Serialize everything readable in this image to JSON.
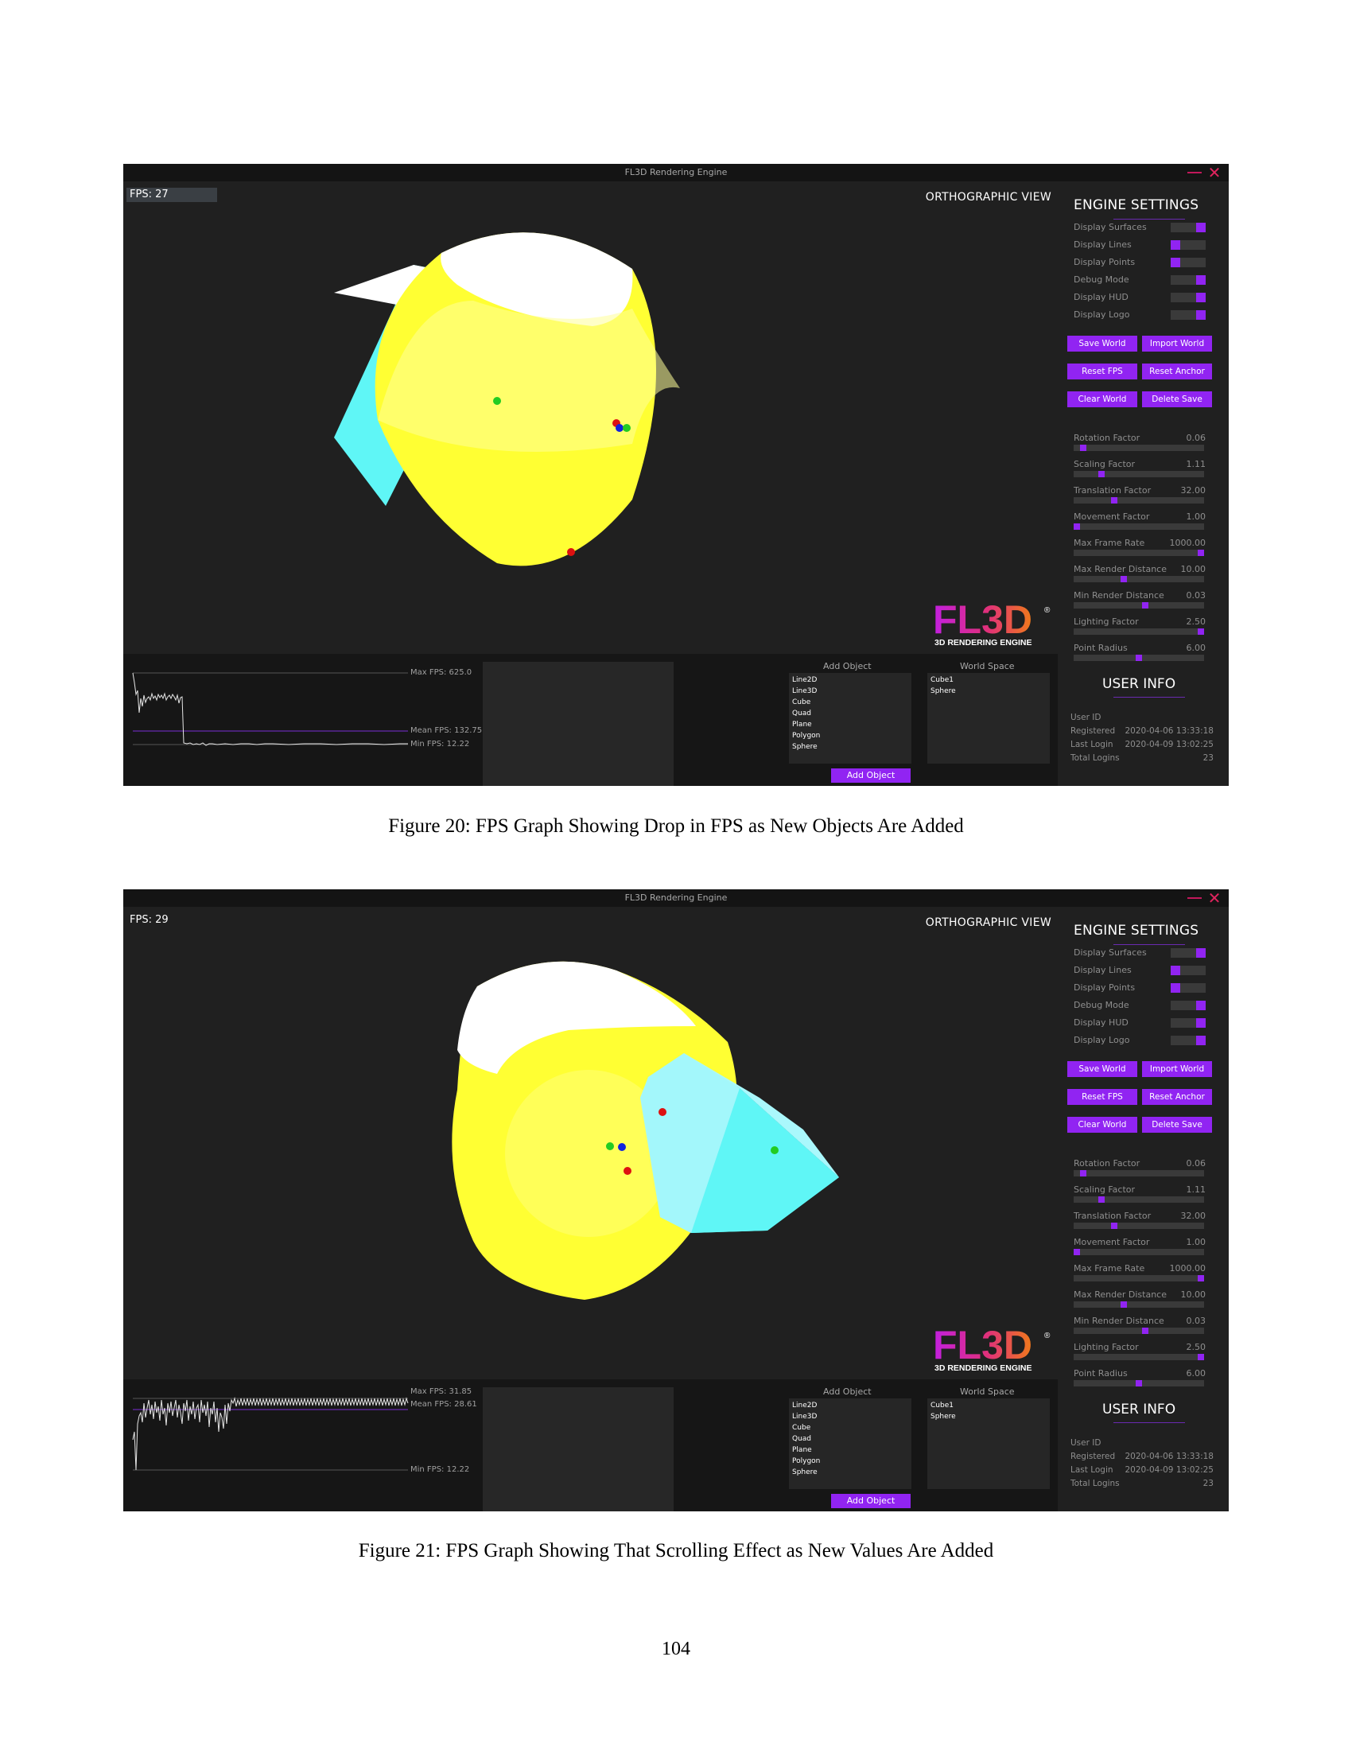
{
  "figures": [
    {
      "window_title": "FL3D Rendering Engine",
      "fps": "FPS: 27",
      "view_label": "ORTHOGRAPHIC VIEW",
      "logo": {
        "text": "FL3D",
        "subtitle": "3D RENDERING ENGINE",
        "mark": "®"
      },
      "graph": {
        "max_label": "Max FPS: 625.0",
        "mean_label": "Mean FPS: 132.75",
        "min_label": "Min FPS: 12.22"
      },
      "add_object": {
        "title": "Add Object",
        "items": [
          "Line2D",
          "Line3D",
          "Cube",
          "Quad",
          "Plane",
          "Polygon",
          "Sphere"
        ],
        "button": "Add Object"
      },
      "world_space": {
        "title": "World Space",
        "items": [
          "Cube1",
          "Sphere"
        ]
      },
      "settings": {
        "title": "ENGINE SETTINGS",
        "toggles": [
          {
            "label": "Display Surfaces",
            "on": true
          },
          {
            "label": "Display Lines",
            "on": false
          },
          {
            "label": "Display Points",
            "on": false
          },
          {
            "label": "Debug Mode",
            "on": true
          },
          {
            "label": "Display HUD",
            "on": true
          },
          {
            "label": "Display Logo",
            "on": true
          }
        ],
        "buttons": [
          "Save World",
          "Import World",
          "Reset FPS",
          "Reset Anchor",
          "Clear World",
          "Delete Save"
        ],
        "sliders": [
          {
            "label": "Rotation Factor",
            "value": "0.06",
            "level": 0.05
          },
          {
            "label": "Scaling Factor",
            "value": "1.11",
            "level": 0.2
          },
          {
            "label": "Translation Factor",
            "value": "32.00",
            "level": 0.3
          },
          {
            "label": "Movement Factor",
            "value": "1.00",
            "level": 0.0
          },
          {
            "label": "Max Frame Rate",
            "value": "1000.00",
            "level": 1.0
          },
          {
            "label": "Max Render Distance",
            "value": "10.00",
            "level": 0.38
          },
          {
            "label": "Min Render Distance",
            "value": "0.03",
            "level": 0.55
          },
          {
            "label": "Lighting Factor",
            "value": "2.50",
            "level": 1.0
          },
          {
            "label": "Point Radius",
            "value": "6.00",
            "level": 0.5
          }
        ]
      },
      "user_info": {
        "title": "USER INFO",
        "rows": [
          {
            "label": "User ID",
            "value": ""
          },
          {
            "label": "Registered",
            "value": "2020-04-06 13:33:18"
          },
          {
            "label": "Last Login",
            "value": "2020-04-09 13:02:25"
          },
          {
            "label": "Total Logins",
            "value": "23"
          }
        ]
      },
      "caption": "Figure 20: FPS Graph Showing Drop in FPS as New Objects Are Added"
    },
    {
      "window_title": "FL3D Rendering Engine",
      "fps": "FPS: 29",
      "view_label": "ORTHOGRAPHIC VIEW",
      "logo": {
        "text": "FL3D",
        "subtitle": "3D RENDERING ENGINE",
        "mark": "®"
      },
      "graph": {
        "max_label": "Max FPS: 31.85",
        "mean_label": "Mean FPS: 28.61",
        "min_label": "Min FPS: 12.22"
      },
      "add_object": {
        "title": "Add Object",
        "items": [
          "Line2D",
          "Line3D",
          "Cube",
          "Quad",
          "Plane",
          "Polygon",
          "Sphere"
        ],
        "button": "Add Object"
      },
      "world_space": {
        "title": "World Space",
        "items": [
          "Cube1",
          "Sphere"
        ]
      },
      "settings": {
        "title": "ENGINE SETTINGS",
        "toggles": [
          {
            "label": "Display Surfaces",
            "on": true
          },
          {
            "label": "Display Lines",
            "on": false
          },
          {
            "label": "Display Points",
            "on": false
          },
          {
            "label": "Debug Mode",
            "on": true
          },
          {
            "label": "Display HUD",
            "on": true
          },
          {
            "label": "Display Logo",
            "on": true
          }
        ],
        "buttons": [
          "Save World",
          "Import World",
          "Reset FPS",
          "Reset Anchor",
          "Clear World",
          "Delete Save"
        ],
        "sliders": [
          {
            "label": "Rotation Factor",
            "value": "0.06",
            "level": 0.05
          },
          {
            "label": "Scaling Factor",
            "value": "1.11",
            "level": 0.2
          },
          {
            "label": "Translation Factor",
            "value": "32.00",
            "level": 0.3
          },
          {
            "label": "Movement Factor",
            "value": "1.00",
            "level": 0.0
          },
          {
            "label": "Max Frame Rate",
            "value": "1000.00",
            "level": 1.0
          },
          {
            "label": "Max Render Distance",
            "value": "10.00",
            "level": 0.38
          },
          {
            "label": "Min Render Distance",
            "value": "0.03",
            "level": 0.55
          },
          {
            "label": "Lighting Factor",
            "value": "2.50",
            "level": 1.0
          },
          {
            "label": "Point Radius",
            "value": "6.00",
            "level": 0.5
          }
        ]
      },
      "user_info": {
        "title": "USER INFO",
        "rows": [
          {
            "label": "User ID",
            "value": ""
          },
          {
            "label": "Registered",
            "value": "2020-04-06 13:33:18"
          },
          {
            "label": "Last Login",
            "value": "2020-04-09 13:02:25"
          },
          {
            "label": "Total Logins",
            "value": "23"
          }
        ]
      },
      "caption": "Figure 21: FPS Graph Showing That Scrolling Effect as New Values Are Added"
    }
  ],
  "page_number": "104",
  "colors": {
    "accent": "#9124f2",
    "background": "#202020",
    "cube": "#5ff6f6",
    "sphere": "#ffff00"
  }
}
